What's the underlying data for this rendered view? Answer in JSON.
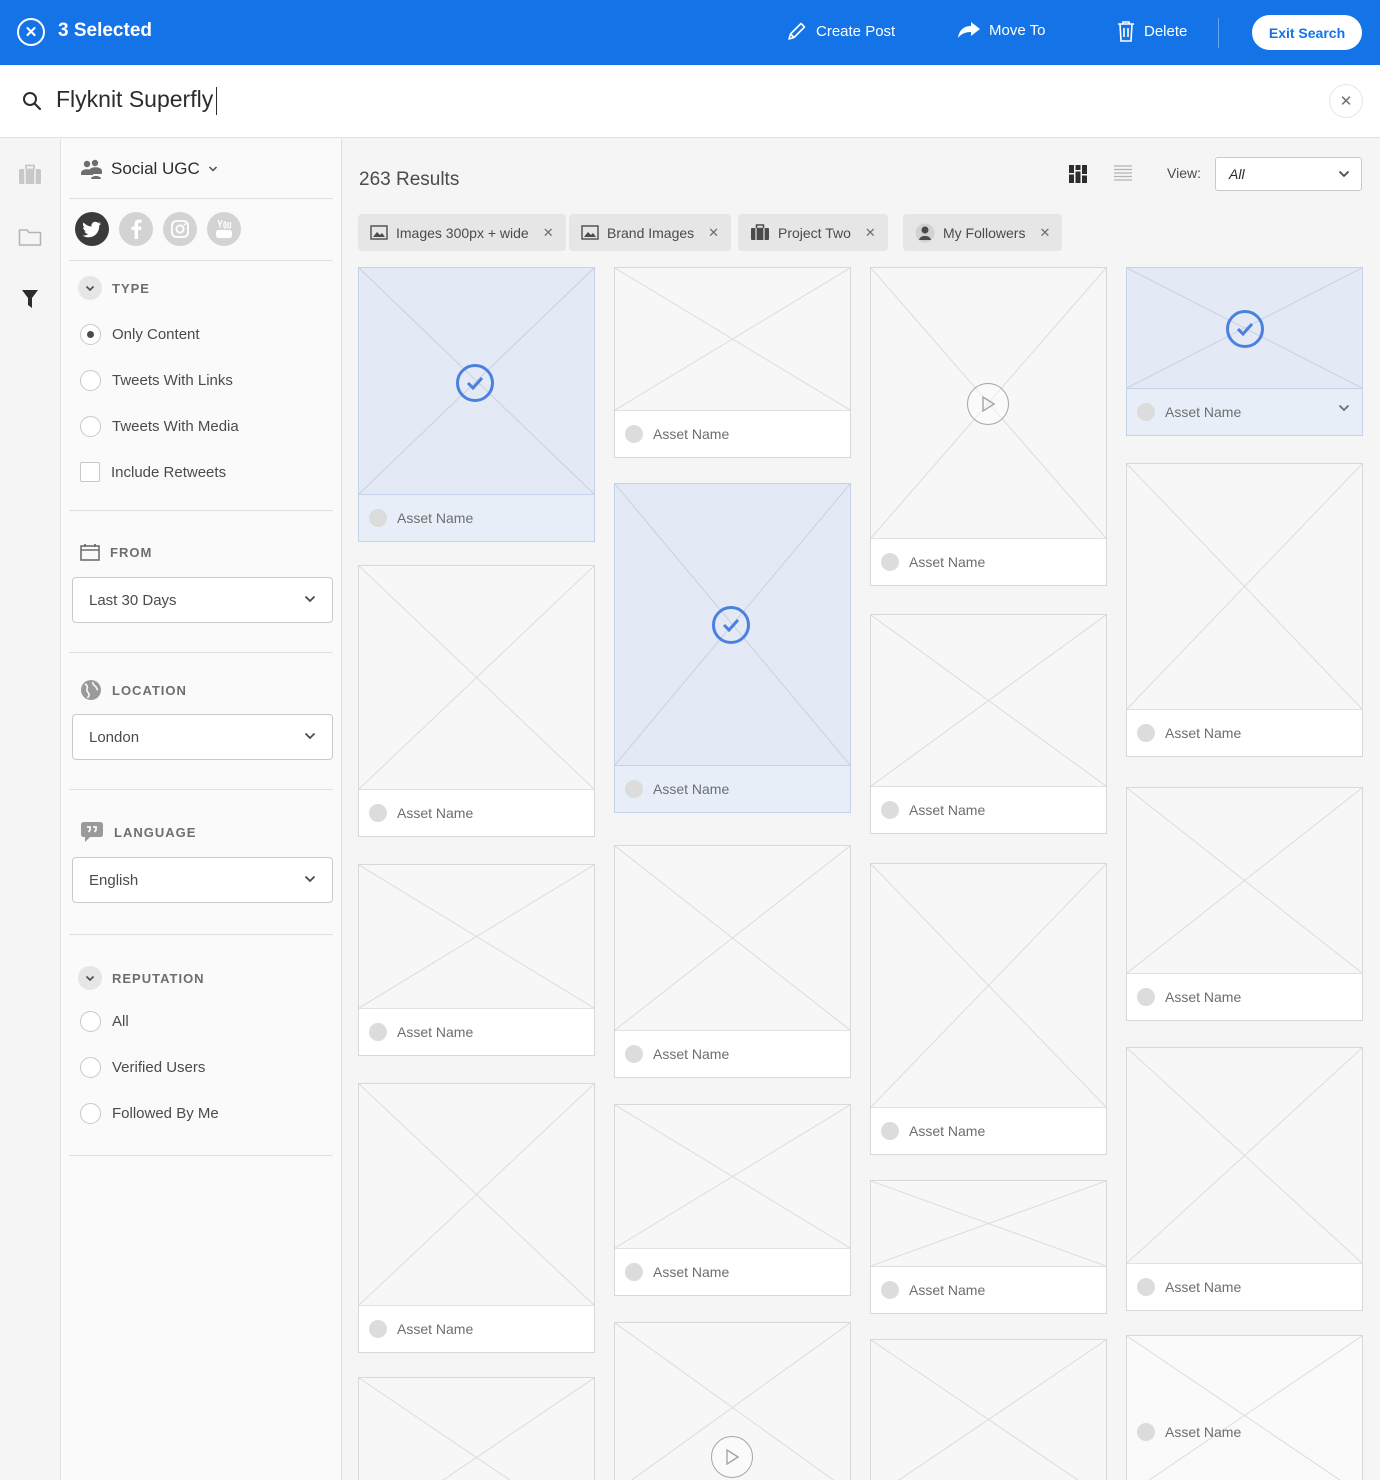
{
  "topbar": {
    "selected_label": "3 Selected",
    "actions": {
      "create_post": "Create Post",
      "move_to": "Move To",
      "delete": "Delete"
    },
    "exit_label": "Exit Search",
    "accent": "#1473e6"
  },
  "search": {
    "query": "Flyknit Superfly"
  },
  "filters": {
    "source": "Social UGC",
    "networks": [
      "twitter-icon",
      "facebook-icon",
      "instagram-icon",
      "youtube-icon"
    ],
    "type": {
      "title": "TYPE",
      "options": [
        {
          "label": "Only Content",
          "selected": true
        },
        {
          "label": "Tweets With Links",
          "selected": false
        },
        {
          "label": "Tweets With Media",
          "selected": false
        }
      ],
      "checkbox": {
        "label": "Include Retweets",
        "checked": false
      }
    },
    "from": {
      "title": "FROM",
      "value": "Last 30 Days"
    },
    "location": {
      "title": "LOCATION",
      "value": "London"
    },
    "language": {
      "title": "LANGUAGE",
      "value": "English"
    },
    "reputation": {
      "title": "REPUTATION",
      "options": [
        {
          "label": "All",
          "selected": false
        },
        {
          "label": "Verified Users",
          "selected": false
        },
        {
          "label": "Followed By Me",
          "selected": false
        }
      ]
    }
  },
  "main": {
    "results": "263 Results",
    "view_label": "View:",
    "view_value": "All",
    "tags": [
      {
        "label": "Images 300px + wide",
        "icon": "image-icon"
      },
      {
        "label": "Brand Images",
        "icon": "image-icon"
      },
      {
        "label": "Project Two",
        "icon": "briefcase-icon"
      },
      {
        "label": "My Followers",
        "icon": "person-icon"
      }
    ],
    "asset_label": "Asset Name",
    "selected_color": "#e3eaf5"
  }
}
